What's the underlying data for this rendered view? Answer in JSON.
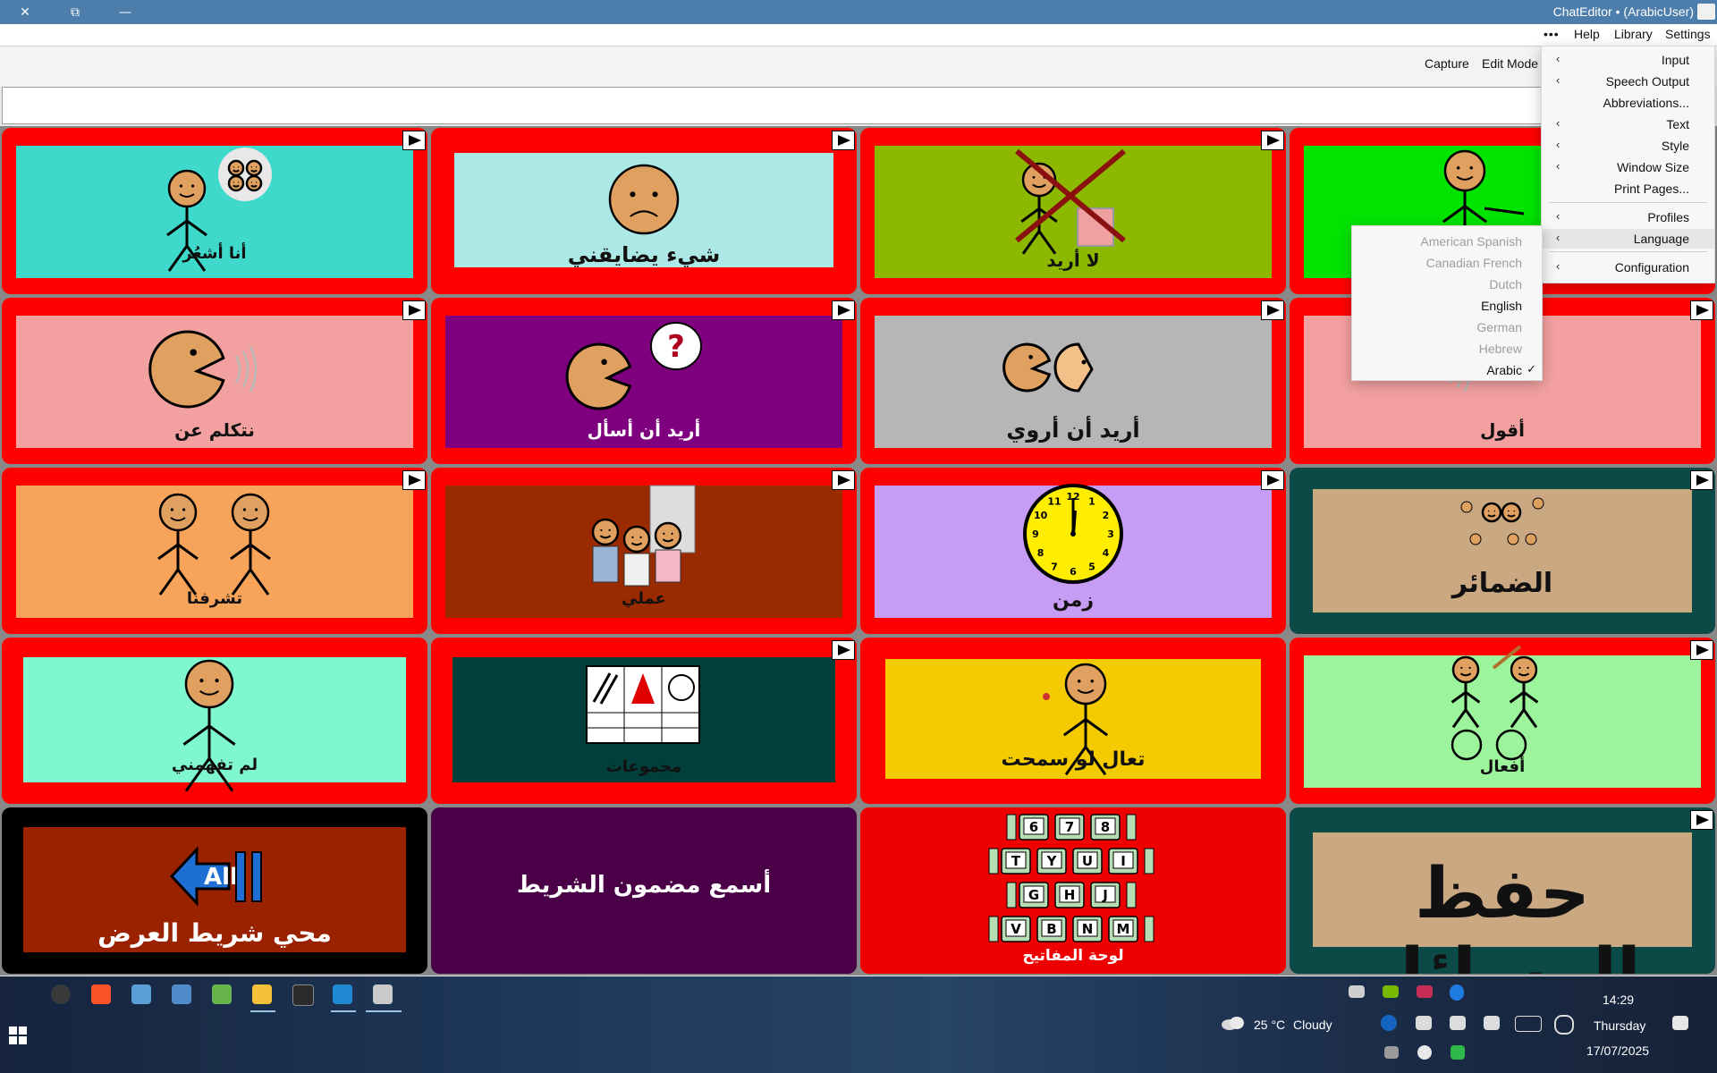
{
  "window": {
    "title": "ChatEditor • (ArabicUser)",
    "close_label": "✕",
    "restore_label": "⧉",
    "minimize_label": "—"
  },
  "menubar": {
    "more_label": "•••",
    "help": "Help",
    "library": "Library",
    "settings": "Settings"
  },
  "toolbar": {
    "capture": "Capture",
    "edit_mode": "Edit Mode"
  },
  "settings_menu": {
    "items": [
      "Input",
      "Speech Output",
      "Abbreviations...",
      "Text",
      "Style",
      "Window Size",
      "Print Pages...",
      "Profiles",
      "Language",
      "Configuration"
    ],
    "highlighted": "Language"
  },
  "language_submenu": {
    "items": [
      "American Spanish",
      "Canadian French",
      "Dutch",
      "English",
      "German",
      "Hebrew",
      "Arabic"
    ],
    "enabled": [
      "English",
      "Arabic"
    ],
    "checked": "Arabic"
  },
  "cells": [
    {
      "label": "أنا أشعُر",
      "bg": "#3fd9cc",
      "border": "#ff0000",
      "arrow": true
    },
    {
      "label": "شيء يضايقني",
      "bg": "#abe8e6",
      "border": "#ff0000",
      "arrow": true
    },
    {
      "label": "لا أريد",
      "bg": "#8cb800",
      "border": "#ff0000",
      "arrow": true
    },
    {
      "label": "",
      "bg": "#00e400",
      "border": "#ff0000",
      "arrow": false
    },
    {
      "label": "نتكلم عن",
      "bg": "#f3a0a0",
      "border": "#ff0000",
      "arrow": true
    },
    {
      "label": "أريد أن أسأل",
      "bg": "#7f007f",
      "border": "#ff0000",
      "arrow": true
    },
    {
      "label": "أريد أن أروي",
      "bg": "#b6b6b6",
      "border": "#ff0000",
      "arrow": true
    },
    {
      "label": "أقول",
      "bg": "#f3a0a0",
      "border": "#ff0000",
      "arrow": true
    },
    {
      "label": "تشرفنا",
      "bg": "#f7a35a",
      "border": "#ff0000",
      "arrow": true
    },
    {
      "label": "عملي",
      "bg": "#9a2a00",
      "border": "#ff0000",
      "arrow": true
    },
    {
      "label": "زمن",
      "bg": "#c79cf5",
      "border": "#ff0000",
      "arrow": true
    },
    {
      "label": "الضمائر",
      "bg": "#c9a882",
      "border": "#0c4a48",
      "arrow": true
    },
    {
      "label": "لم تفهمني",
      "bg": "#7ff7cf",
      "border": "#ff0000",
      "arrow": false
    },
    {
      "label": "مجموعات",
      "bg": "#003f3b",
      "border": "#ff0000",
      "arrow": true
    },
    {
      "label": "تعال لو سمحت",
      "bg": "#f3cb00",
      "border": "#ff0000",
      "arrow": false
    },
    {
      "label": "أفعال",
      "bg": "#9cf59c",
      "border": "#ff0000",
      "arrow": true
    },
    {
      "label": "محي شريط العرض",
      "bg": "#9a2200",
      "border": "#000000",
      "arrow": false
    },
    {
      "label": "أسمع مضمون الشريط",
      "bg": "#4a0047",
      "border": "#4a0047",
      "arrow": false
    },
    {
      "label": "لوحة المفاتيح",
      "bg": "#ee0000",
      "border": "#ee0000",
      "arrow": false
    },
    {
      "label": "حفظ الرسائل",
      "bg": "#c9a882",
      "border": "#0c4a48",
      "arrow": true
    }
  ],
  "pictures": {
    "all_button": "All",
    "keyboard_rows": [
      [
        "6",
        "7",
        "8"
      ],
      [
        "T",
        "Y",
        "U",
        "I"
      ],
      [
        "G",
        "H",
        "J"
      ],
      [
        "V",
        "B",
        "N",
        "M"
      ]
    ],
    "clock_numbers": [
      "12",
      "1",
      "2",
      "3",
      "4",
      "5",
      "6",
      "7",
      "8",
      "9",
      "10",
      "11"
    ],
    "question_mark": "?"
  },
  "taskbar": {
    "weather_temp": "25 °C",
    "weather_desc": "Cloudy",
    "time": "14:29",
    "day": "Thursday",
    "date": "17/07/2025"
  }
}
